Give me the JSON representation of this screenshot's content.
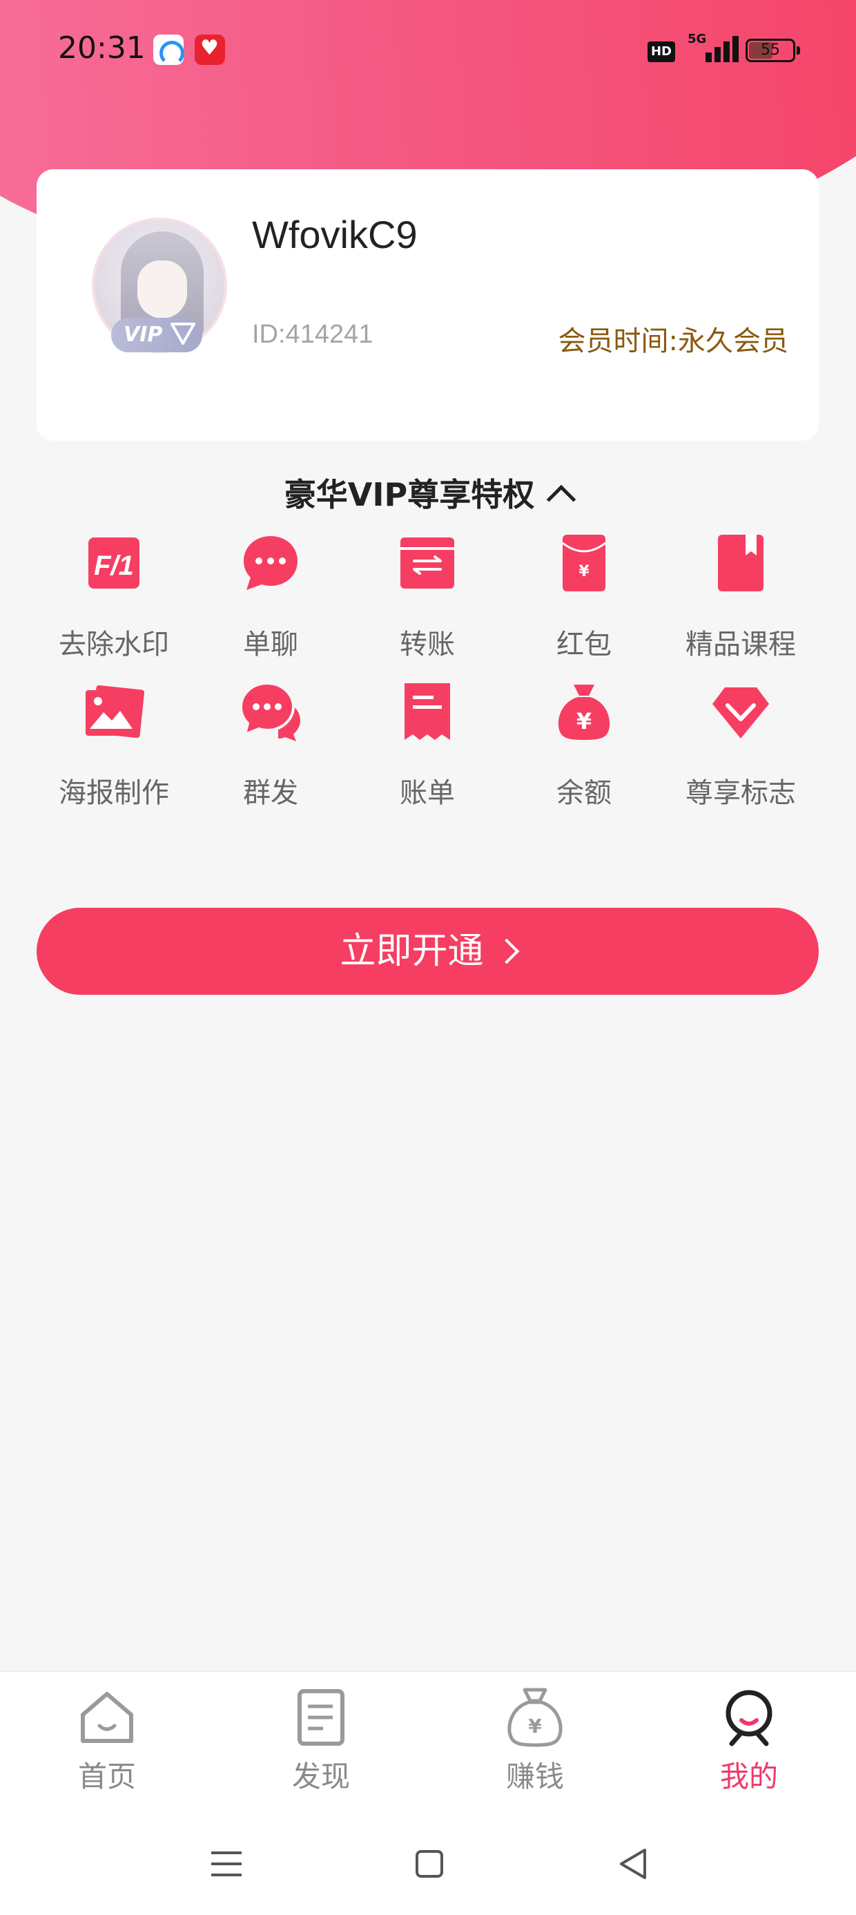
{
  "status_bar": {
    "time": "20:31",
    "network": "5G",
    "battery": "55",
    "battery_level": 0.55,
    "hd_label": "HD"
  },
  "profile": {
    "username": "WfovikC9",
    "user_id": "ID:414241",
    "member_time": "会员时间:永久会员",
    "vip_badge": "VIP",
    "avatar_icon": "anime-girl-avatar"
  },
  "privileges": {
    "title": "豪华VIP尊享特权",
    "items": [
      {
        "label": "去除水印",
        "icon": "remove-watermark-icon"
      },
      {
        "label": "单聊",
        "icon": "chat-bubble-icon"
      },
      {
        "label": "转账",
        "icon": "transfer-icon"
      },
      {
        "label": "红包",
        "icon": "red-envelope-icon"
      },
      {
        "label": "精品课程",
        "icon": "course-book-icon"
      },
      {
        "label": "海报制作",
        "icon": "poster-image-icon"
      },
      {
        "label": "群发",
        "icon": "group-chat-icon"
      },
      {
        "label": "账单",
        "icon": "bill-icon"
      },
      {
        "label": "余额",
        "icon": "money-bag-icon"
      },
      {
        "label": "尊享标志",
        "icon": "vip-diamond-icon"
      }
    ]
  },
  "cta": {
    "label": "立即开通"
  },
  "bottom_nav": {
    "items": [
      {
        "label": "首页",
        "icon": "home-icon",
        "active": false
      },
      {
        "label": "发现",
        "icon": "discover-icon",
        "active": false
      },
      {
        "label": "赚钱",
        "icon": "money-bag-icon",
        "active": false
      },
      {
        "label": "我的",
        "icon": "profile-icon",
        "active": true
      }
    ]
  },
  "colors": {
    "brand": "#f63e62",
    "active_nav": "#f1386a",
    "member_text": "#8a5a0e"
  }
}
